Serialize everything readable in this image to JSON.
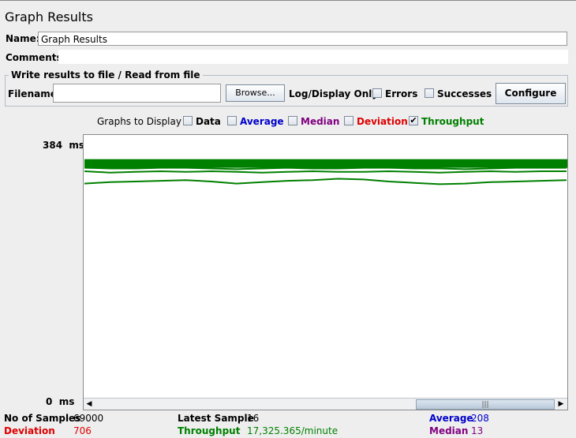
{
  "window": {
    "title": "Graph Results"
  },
  "form": {
    "name_label": "Name:",
    "name_value": "Graph Results",
    "comments_label": "Comments:",
    "comments_value": ""
  },
  "file_group": {
    "legend": "Write results to file / Read from file",
    "filename_label": "Filename",
    "filename_value": "",
    "browse_label": "Browse...",
    "log_display_label": "Log/Display Only:",
    "errors_label": "Errors",
    "errors_checked": false,
    "successes_label": "Successes",
    "successes_checked": false,
    "configure_label": "Configure"
  },
  "graphs": {
    "label": "Graphs to Display",
    "options": [
      {
        "label": "Data",
        "checked": false,
        "color": "#000000"
      },
      {
        "label": "Average",
        "checked": false,
        "color": "#0000cc"
      },
      {
        "label": "Median",
        "checked": false,
        "color": "#800080"
      },
      {
        "label": "Deviation",
        "checked": false,
        "color": "#e00000"
      },
      {
        "label": "Throughput",
        "checked": true,
        "color": "#008000"
      }
    ]
  },
  "chart": {
    "y_max_label": "384  ms",
    "y_min_label": "0  ms",
    "line_color": "#008000"
  },
  "chart_data": {
    "type": "line",
    "title": "",
    "xlabel": "",
    "ylabel": "",
    "ylim": [
      0,
      384
    ],
    "grid": false,
    "series": [
      {
        "values": [
          344,
          342,
          343,
          342,
          343,
          342,
          341,
          342,
          343,
          342,
          341,
          342,
          343,
          342,
          342,
          343,
          342,
          341,
          342,
          343
        ]
      },
      {
        "values": [
          336,
          335,
          335,
          336,
          336,
          335,
          334,
          335,
          336,
          335,
          335,
          336,
          336,
          335,
          335,
          334,
          335,
          336,
          336,
          336
        ]
      },
      {
        "values": [
          331,
          329,
          330,
          331,
          330,
          331,
          330,
          329,
          330,
          331,
          330,
          330,
          331,
          330,
          329,
          330,
          331,
          330,
          331,
          331
        ]
      },
      {
        "values": [
          313,
          315,
          316,
          317,
          318,
          316,
          313,
          315,
          317,
          318,
          320,
          319,
          316,
          314,
          312,
          313,
          315,
          316,
          317,
          318
        ]
      }
    ]
  },
  "stats": {
    "samples_label": "No of Samples",
    "samples_value": "69000",
    "latest_label": "Latest Sample",
    "latest_value": "16",
    "average_label": "Average",
    "average_value": "208",
    "deviation_label": "Deviation",
    "deviation_value": "706",
    "throughput_label": "Throughput",
    "throughput_value": "17,325.365/minute",
    "median_label": "Median",
    "median_value": "13",
    "colors": {
      "black": "#000000",
      "red": "#e00000",
      "green": "#008000",
      "blue": "#0000cc",
      "purple": "#800080"
    }
  },
  "scrollbar": {
    "left_icon": "arrow-left-icon",
    "right_icon": "arrow-right-icon",
    "thumb_grip": "|||"
  }
}
